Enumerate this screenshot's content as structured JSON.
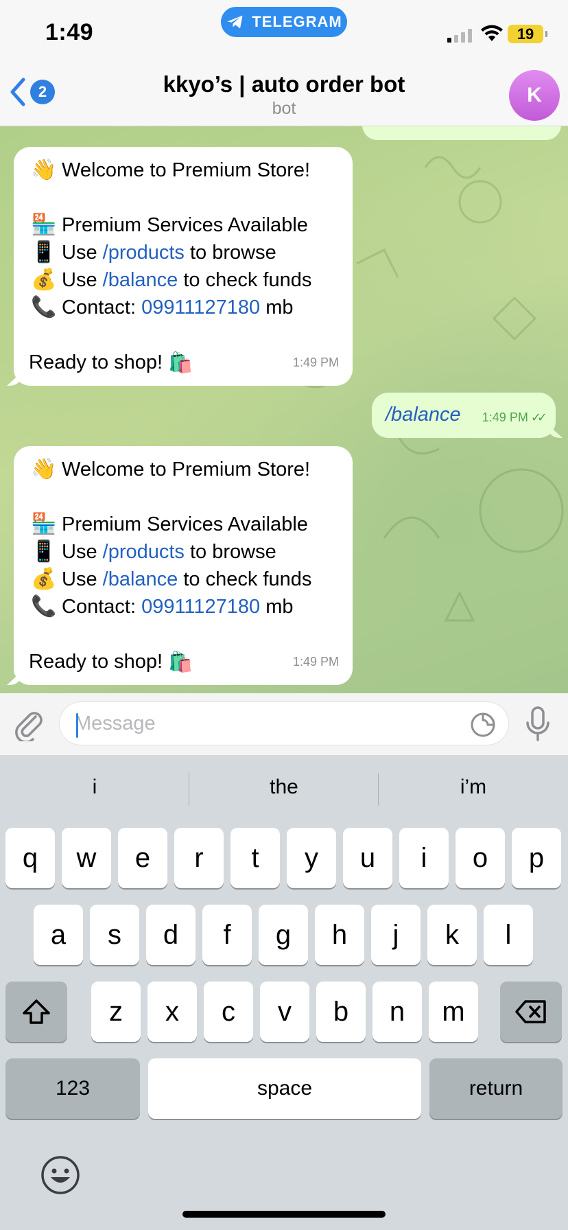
{
  "status": {
    "time": "1:49",
    "app": "TELEGRAM",
    "battery": "19"
  },
  "header": {
    "back_count": "2",
    "title": "kkyo’s | auto order bot",
    "subtitle": "bot",
    "avatar_letter": "K"
  },
  "messages": [
    {
      "direction": "in",
      "time": "1:49 PM",
      "lines": [
        {
          "emoji": "👋",
          "parts": [
            {
              "t": "Welcome to Premium Store!"
            }
          ]
        },
        {
          "blank": true
        },
        {
          "emoji": "🏪",
          "parts": [
            {
              "t": "Premium Services Available"
            }
          ]
        },
        {
          "emoji": "📱",
          "parts": [
            {
              "t": "Use "
            },
            {
              "t": "/products",
              "link": true
            },
            {
              "t": " to browse"
            }
          ]
        },
        {
          "emoji": "💰",
          "parts": [
            {
              "t": "Use "
            },
            {
              "t": "/balance",
              "link": true
            },
            {
              "t": " to check funds"
            }
          ]
        },
        {
          "emoji": "📞",
          "parts": [
            {
              "t": "Contact: "
            },
            {
              "t": "09911127180",
              "link": true
            },
            {
              "t": " mb"
            }
          ]
        },
        {
          "blank": true
        },
        {
          "emoji": "",
          "parts": [
            {
              "t": "Ready to shop! "
            }
          ],
          "trailing_emoji": "🛍️"
        }
      ]
    },
    {
      "direction": "out",
      "text": "/balance",
      "time": "1:49 PM"
    },
    {
      "direction": "in",
      "time": "1:49 PM",
      "lines": [
        {
          "emoji": "👋",
          "parts": [
            {
              "t": "Welcome to Premium Store!"
            }
          ]
        },
        {
          "blank": true
        },
        {
          "emoji": "🏪",
          "parts": [
            {
              "t": "Premium Services Available"
            }
          ]
        },
        {
          "emoji": "📱",
          "parts": [
            {
              "t": "Use "
            },
            {
              "t": "/products",
              "link": true
            },
            {
              "t": " to browse"
            }
          ]
        },
        {
          "emoji": "💰",
          "parts": [
            {
              "t": "Use "
            },
            {
              "t": "/balance",
              "link": true
            },
            {
              "t": " to check funds"
            }
          ]
        },
        {
          "emoji": "📞",
          "parts": [
            {
              "t": "Contact: "
            },
            {
              "t": "09911127180",
              "link": true
            },
            {
              "t": " mb"
            }
          ]
        },
        {
          "blank": true
        },
        {
          "emoji": "",
          "parts": [
            {
              "t": "Ready to shop! "
            }
          ],
          "trailing_emoji": "🛍️"
        }
      ]
    }
  ],
  "input": {
    "placeholder": "Message",
    "value": ""
  },
  "keyboard": {
    "suggestions": [
      "i",
      "the",
      "i’m"
    ],
    "row1": [
      "q",
      "w",
      "e",
      "r",
      "t",
      "y",
      "u",
      "i",
      "o",
      "p"
    ],
    "row2": [
      "a",
      "s",
      "d",
      "f",
      "g",
      "h",
      "j",
      "k",
      "l"
    ],
    "row3": [
      "z",
      "x",
      "c",
      "v",
      "b",
      "n",
      "m"
    ],
    "numbers_label": "123",
    "space_label": "space",
    "return_label": "return"
  },
  "colors": {
    "link": "#2361c0",
    "accent": "#2f80e0",
    "outgoing_bubble": "#e6fdd2",
    "battery": "#f2d230",
    "avatar": "#c25ad8"
  }
}
